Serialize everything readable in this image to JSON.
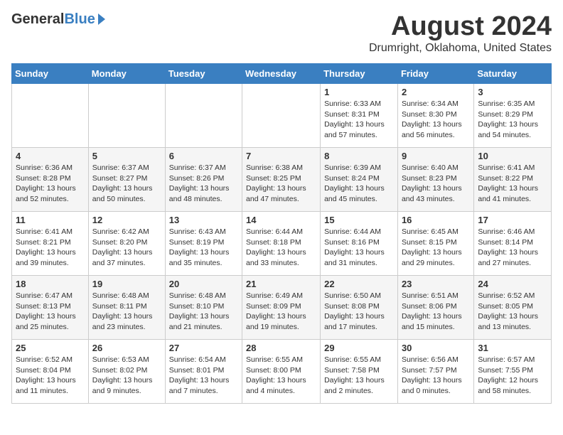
{
  "header": {
    "logo_general": "General",
    "logo_blue": "Blue",
    "month_year": "August 2024",
    "location": "Drumright, Oklahoma, United States"
  },
  "days_of_week": [
    "Sunday",
    "Monday",
    "Tuesday",
    "Wednesday",
    "Thursday",
    "Friday",
    "Saturday"
  ],
  "weeks": [
    [
      {
        "day": "",
        "info": ""
      },
      {
        "day": "",
        "info": ""
      },
      {
        "day": "",
        "info": ""
      },
      {
        "day": "",
        "info": ""
      },
      {
        "day": "1",
        "info": "Sunrise: 6:33 AM\nSunset: 8:31 PM\nDaylight: 13 hours\nand 57 minutes."
      },
      {
        "day": "2",
        "info": "Sunrise: 6:34 AM\nSunset: 8:30 PM\nDaylight: 13 hours\nand 56 minutes."
      },
      {
        "day": "3",
        "info": "Sunrise: 6:35 AM\nSunset: 8:29 PM\nDaylight: 13 hours\nand 54 minutes."
      }
    ],
    [
      {
        "day": "4",
        "info": "Sunrise: 6:36 AM\nSunset: 8:28 PM\nDaylight: 13 hours\nand 52 minutes."
      },
      {
        "day": "5",
        "info": "Sunrise: 6:37 AM\nSunset: 8:27 PM\nDaylight: 13 hours\nand 50 minutes."
      },
      {
        "day": "6",
        "info": "Sunrise: 6:37 AM\nSunset: 8:26 PM\nDaylight: 13 hours\nand 48 minutes."
      },
      {
        "day": "7",
        "info": "Sunrise: 6:38 AM\nSunset: 8:25 PM\nDaylight: 13 hours\nand 47 minutes."
      },
      {
        "day": "8",
        "info": "Sunrise: 6:39 AM\nSunset: 8:24 PM\nDaylight: 13 hours\nand 45 minutes."
      },
      {
        "day": "9",
        "info": "Sunrise: 6:40 AM\nSunset: 8:23 PM\nDaylight: 13 hours\nand 43 minutes."
      },
      {
        "day": "10",
        "info": "Sunrise: 6:41 AM\nSunset: 8:22 PM\nDaylight: 13 hours\nand 41 minutes."
      }
    ],
    [
      {
        "day": "11",
        "info": "Sunrise: 6:41 AM\nSunset: 8:21 PM\nDaylight: 13 hours\nand 39 minutes."
      },
      {
        "day": "12",
        "info": "Sunrise: 6:42 AM\nSunset: 8:20 PM\nDaylight: 13 hours\nand 37 minutes."
      },
      {
        "day": "13",
        "info": "Sunrise: 6:43 AM\nSunset: 8:19 PM\nDaylight: 13 hours\nand 35 minutes."
      },
      {
        "day": "14",
        "info": "Sunrise: 6:44 AM\nSunset: 8:18 PM\nDaylight: 13 hours\nand 33 minutes."
      },
      {
        "day": "15",
        "info": "Sunrise: 6:44 AM\nSunset: 8:16 PM\nDaylight: 13 hours\nand 31 minutes."
      },
      {
        "day": "16",
        "info": "Sunrise: 6:45 AM\nSunset: 8:15 PM\nDaylight: 13 hours\nand 29 minutes."
      },
      {
        "day": "17",
        "info": "Sunrise: 6:46 AM\nSunset: 8:14 PM\nDaylight: 13 hours\nand 27 minutes."
      }
    ],
    [
      {
        "day": "18",
        "info": "Sunrise: 6:47 AM\nSunset: 8:13 PM\nDaylight: 13 hours\nand 25 minutes."
      },
      {
        "day": "19",
        "info": "Sunrise: 6:48 AM\nSunset: 8:11 PM\nDaylight: 13 hours\nand 23 minutes."
      },
      {
        "day": "20",
        "info": "Sunrise: 6:48 AM\nSunset: 8:10 PM\nDaylight: 13 hours\nand 21 minutes."
      },
      {
        "day": "21",
        "info": "Sunrise: 6:49 AM\nSunset: 8:09 PM\nDaylight: 13 hours\nand 19 minutes."
      },
      {
        "day": "22",
        "info": "Sunrise: 6:50 AM\nSunset: 8:08 PM\nDaylight: 13 hours\nand 17 minutes."
      },
      {
        "day": "23",
        "info": "Sunrise: 6:51 AM\nSunset: 8:06 PM\nDaylight: 13 hours\nand 15 minutes."
      },
      {
        "day": "24",
        "info": "Sunrise: 6:52 AM\nSunset: 8:05 PM\nDaylight: 13 hours\nand 13 minutes."
      }
    ],
    [
      {
        "day": "25",
        "info": "Sunrise: 6:52 AM\nSunset: 8:04 PM\nDaylight: 13 hours\nand 11 minutes."
      },
      {
        "day": "26",
        "info": "Sunrise: 6:53 AM\nSunset: 8:02 PM\nDaylight: 13 hours\nand 9 minutes."
      },
      {
        "day": "27",
        "info": "Sunrise: 6:54 AM\nSunset: 8:01 PM\nDaylight: 13 hours\nand 7 minutes."
      },
      {
        "day": "28",
        "info": "Sunrise: 6:55 AM\nSunset: 8:00 PM\nDaylight: 13 hours\nand 4 minutes."
      },
      {
        "day": "29",
        "info": "Sunrise: 6:55 AM\nSunset: 7:58 PM\nDaylight: 13 hours\nand 2 minutes."
      },
      {
        "day": "30",
        "info": "Sunrise: 6:56 AM\nSunset: 7:57 PM\nDaylight: 13 hours\nand 0 minutes."
      },
      {
        "day": "31",
        "info": "Sunrise: 6:57 AM\nSunset: 7:55 PM\nDaylight: 12 hours\nand 58 minutes."
      }
    ]
  ]
}
